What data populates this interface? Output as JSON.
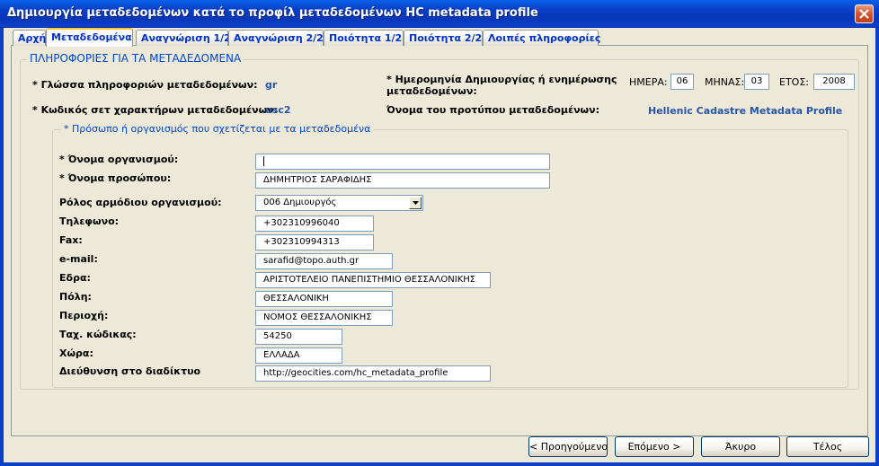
{
  "window": {
    "title": "Δημιουργία μεταδεδομένων κατά το προφίλ μεταδεδομένων HC metadata profile"
  },
  "tabs": [
    {
      "label": "Αρχή",
      "active": false
    },
    {
      "label": "Μεταδεδομένα",
      "active": true
    },
    {
      "label": "Αναγνώριση 1/2",
      "active": false
    },
    {
      "label": "Αναγνώριση 2/2",
      "active": false
    },
    {
      "label": "Ποιότητα 1/2",
      "active": false
    },
    {
      "label": "Ποιότητα 2/2",
      "active": false
    },
    {
      "label": "Λοιπές πληροφορίες",
      "active": false
    }
  ],
  "metadata_info": {
    "group_title": "ΠΛΗΡΟΦΟΡΙΕΣ ΓΙΑ ΤΑ ΜΕΤΑΔΕΔΟΜΕΝΑ",
    "language_label": "* Γλώσσα πληροφοριών μεταδεδομένων:",
    "language_value": "gr",
    "charset_label": "* Κωδικός σετ χαρακτήρων μεταδεδομένων:",
    "charset_value": "usc2",
    "date_label_line1": "* Ημερομηνία Δημιουργίας ή ενημέρωσης",
    "date_label_line2": "μεταδεδομένων:",
    "day_label": "ΗΜΕΡΑ:",
    "day_value": "06",
    "month_label": "ΜΗΝΑΣ:",
    "month_value": "03",
    "year_label": "ΕΤΟΣ:",
    "year_value": "2008",
    "standard_label": "Όνομα του προτύπου μεταδεδομένων:",
    "standard_value": "Hellenic Cadastre Metadata Profile"
  },
  "contact": {
    "group_title": "* Πρόσωπο ή οργανισμός που σχετίζεται με τα μεταδεδομένα",
    "fields": [
      {
        "label": "* Όνομα οργανισμού:",
        "value": ""
      },
      {
        "label": " * Όνομα προσώπου:",
        "value": "ΔΗΜΗΤΡΙΟΣ ΣΑΡΑΦΙΔΗΣ"
      },
      {
        "label": "Ρόλος αρμόδιου οργανισμού:",
        "value": "006 Δημιουργός"
      },
      {
        "label": "Τηλεφωνο:",
        "value": "+302310996040"
      },
      {
        "label": "Fax:",
        "value": "+302310994313"
      },
      {
        "label": "e-mail:",
        "value": "sarafid@topo.auth.gr"
      },
      {
        "label": "Εδρα:",
        "value": "ΑΡΙΣΤΟΤΕΛΕΙΟ ΠΑΝΕΠΙΣΤΗΜΙΟ ΘΕΣΣΑΛΟΝΙΚΗΣ"
      },
      {
        "label": "Πόλη:",
        "value": "ΘΕΣΣΑΛΟΝΙΚΗ"
      },
      {
        "label": "Περιοχή:",
        "value": "ΝΟΜΟΣ ΘΕΣΣΑΛΟΝΙΚΗΣ"
      },
      {
        "label": "Ταχ. κώδικας:",
        "value": "54250"
      },
      {
        "label": "Χώρα:",
        "value": "ΕΛΛΑΔΑ"
      },
      {
        "label": " Διεύθυνση στο διαδίκτυο",
        "value": "http://geocities.com/hc_metadata_profile"
      }
    ]
  },
  "buttons": {
    "previous": "< Προηγούμενο",
    "next": "Επόμενο >",
    "cancel": "Άκυρο",
    "finish": "Τέλος"
  },
  "colors": {
    "titlebar": "#0A3FC8",
    "tab_text": "#0033CC",
    "group_title": "#0046D5",
    "value_text": "#2A55A8",
    "face": "#ECE9D8"
  }
}
